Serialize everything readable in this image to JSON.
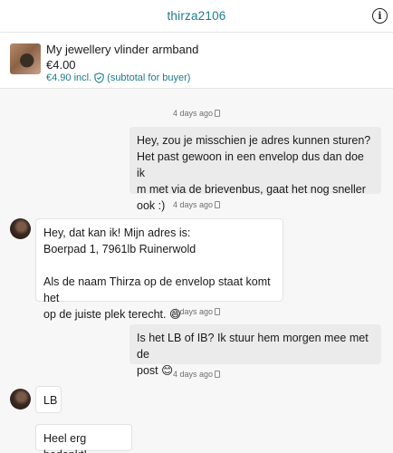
{
  "header": {
    "title": "thirza2106",
    "info_icon": "info-icon"
  },
  "item": {
    "title": "My jewellery vlinder armband",
    "price": "€4.00",
    "incl_price": "€4.90 incl.",
    "subtotal_note": "(subtotal for buyer)",
    "shield_icon": "shield-check-icon"
  },
  "messages": {
    "ts1": "4 days ago",
    "msg1": "Hey, zou je misschien je adres kunnen sturen?\nHet past gewoon in een envelop dus dan doe ik\nm met via de brievenbus, gaat het nog sneller\nook :)",
    "ts2": "4 days ago",
    "msg2": "Hey, dat kan ik! Mijn adres is:\nBoerpad 1, 7961lb Ruinerwold\n\nAls de naam Thirza op de envelop staat komt het\nop de juiste plek terecht. 😄",
    "ts3": "4 days ago",
    "msg3": "Is het LB of IB? Ik stuur hem morgen mee met de\npost 😊",
    "ts4": "4 days ago",
    "msg4": "LB",
    "msg5": "Heel erg bedankt!"
  },
  "colors": {
    "accent": "#1d7a8c",
    "outgoing_bubble": "#ebebeb",
    "incoming_bubble": "#ffffff"
  }
}
